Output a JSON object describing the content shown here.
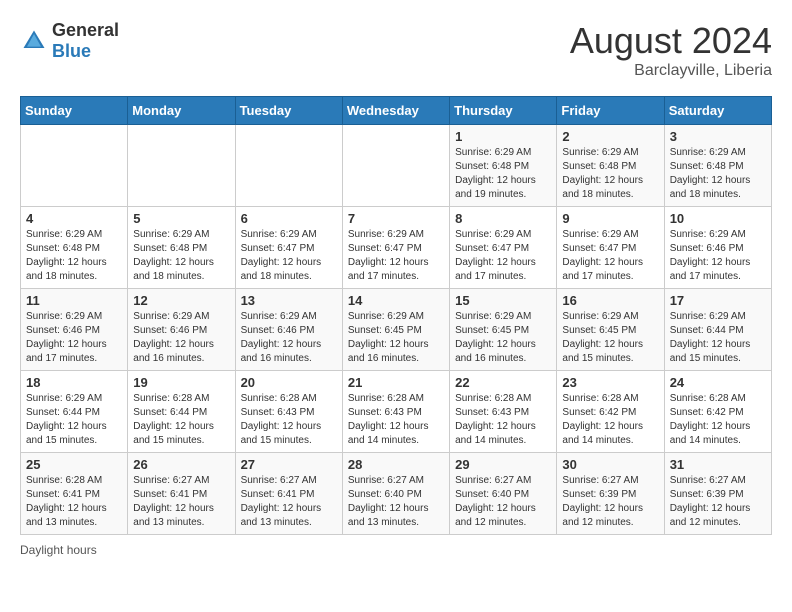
{
  "header": {
    "logo": {
      "general": "General",
      "blue": "Blue"
    },
    "title": "August 2024",
    "location": "Barclayville, Liberia"
  },
  "days_of_week": [
    "Sunday",
    "Monday",
    "Tuesday",
    "Wednesday",
    "Thursday",
    "Friday",
    "Saturday"
  ],
  "weeks": [
    [
      {
        "day": "",
        "info": ""
      },
      {
        "day": "",
        "info": ""
      },
      {
        "day": "",
        "info": ""
      },
      {
        "day": "",
        "info": ""
      },
      {
        "day": "1",
        "info": "Sunrise: 6:29 AM\nSunset: 6:48 PM\nDaylight: 12 hours\nand 19 minutes."
      },
      {
        "day": "2",
        "info": "Sunrise: 6:29 AM\nSunset: 6:48 PM\nDaylight: 12 hours\nand 18 minutes."
      },
      {
        "day": "3",
        "info": "Sunrise: 6:29 AM\nSunset: 6:48 PM\nDaylight: 12 hours\nand 18 minutes."
      }
    ],
    [
      {
        "day": "4",
        "info": "Sunrise: 6:29 AM\nSunset: 6:48 PM\nDaylight: 12 hours\nand 18 minutes."
      },
      {
        "day": "5",
        "info": "Sunrise: 6:29 AM\nSunset: 6:48 PM\nDaylight: 12 hours\nand 18 minutes."
      },
      {
        "day": "6",
        "info": "Sunrise: 6:29 AM\nSunset: 6:47 PM\nDaylight: 12 hours\nand 18 minutes."
      },
      {
        "day": "7",
        "info": "Sunrise: 6:29 AM\nSunset: 6:47 PM\nDaylight: 12 hours\nand 17 minutes."
      },
      {
        "day": "8",
        "info": "Sunrise: 6:29 AM\nSunset: 6:47 PM\nDaylight: 12 hours\nand 17 minutes."
      },
      {
        "day": "9",
        "info": "Sunrise: 6:29 AM\nSunset: 6:47 PM\nDaylight: 12 hours\nand 17 minutes."
      },
      {
        "day": "10",
        "info": "Sunrise: 6:29 AM\nSunset: 6:46 PM\nDaylight: 12 hours\nand 17 minutes."
      }
    ],
    [
      {
        "day": "11",
        "info": "Sunrise: 6:29 AM\nSunset: 6:46 PM\nDaylight: 12 hours\nand 17 minutes."
      },
      {
        "day": "12",
        "info": "Sunrise: 6:29 AM\nSunset: 6:46 PM\nDaylight: 12 hours\nand 16 minutes."
      },
      {
        "day": "13",
        "info": "Sunrise: 6:29 AM\nSunset: 6:46 PM\nDaylight: 12 hours\nand 16 minutes."
      },
      {
        "day": "14",
        "info": "Sunrise: 6:29 AM\nSunset: 6:45 PM\nDaylight: 12 hours\nand 16 minutes."
      },
      {
        "day": "15",
        "info": "Sunrise: 6:29 AM\nSunset: 6:45 PM\nDaylight: 12 hours\nand 16 minutes."
      },
      {
        "day": "16",
        "info": "Sunrise: 6:29 AM\nSunset: 6:45 PM\nDaylight: 12 hours\nand 15 minutes."
      },
      {
        "day": "17",
        "info": "Sunrise: 6:29 AM\nSunset: 6:44 PM\nDaylight: 12 hours\nand 15 minutes."
      }
    ],
    [
      {
        "day": "18",
        "info": "Sunrise: 6:29 AM\nSunset: 6:44 PM\nDaylight: 12 hours\nand 15 minutes."
      },
      {
        "day": "19",
        "info": "Sunrise: 6:28 AM\nSunset: 6:44 PM\nDaylight: 12 hours\nand 15 minutes."
      },
      {
        "day": "20",
        "info": "Sunrise: 6:28 AM\nSunset: 6:43 PM\nDaylight: 12 hours\nand 15 minutes."
      },
      {
        "day": "21",
        "info": "Sunrise: 6:28 AM\nSunset: 6:43 PM\nDaylight: 12 hours\nand 14 minutes."
      },
      {
        "day": "22",
        "info": "Sunrise: 6:28 AM\nSunset: 6:43 PM\nDaylight: 12 hours\nand 14 minutes."
      },
      {
        "day": "23",
        "info": "Sunrise: 6:28 AM\nSunset: 6:42 PM\nDaylight: 12 hours\nand 14 minutes."
      },
      {
        "day": "24",
        "info": "Sunrise: 6:28 AM\nSunset: 6:42 PM\nDaylight: 12 hours\nand 14 minutes."
      }
    ],
    [
      {
        "day": "25",
        "info": "Sunrise: 6:28 AM\nSunset: 6:41 PM\nDaylight: 12 hours\nand 13 minutes."
      },
      {
        "day": "26",
        "info": "Sunrise: 6:27 AM\nSunset: 6:41 PM\nDaylight: 12 hours\nand 13 minutes."
      },
      {
        "day": "27",
        "info": "Sunrise: 6:27 AM\nSunset: 6:41 PM\nDaylight: 12 hours\nand 13 minutes."
      },
      {
        "day": "28",
        "info": "Sunrise: 6:27 AM\nSunset: 6:40 PM\nDaylight: 12 hours\nand 13 minutes."
      },
      {
        "day": "29",
        "info": "Sunrise: 6:27 AM\nSunset: 6:40 PM\nDaylight: 12 hours\nand 12 minutes."
      },
      {
        "day": "30",
        "info": "Sunrise: 6:27 AM\nSunset: 6:39 PM\nDaylight: 12 hours\nand 12 minutes."
      },
      {
        "day": "31",
        "info": "Sunrise: 6:27 AM\nSunset: 6:39 PM\nDaylight: 12 hours\nand 12 minutes."
      }
    ]
  ],
  "footer": {
    "daylight_label": "Daylight hours"
  }
}
